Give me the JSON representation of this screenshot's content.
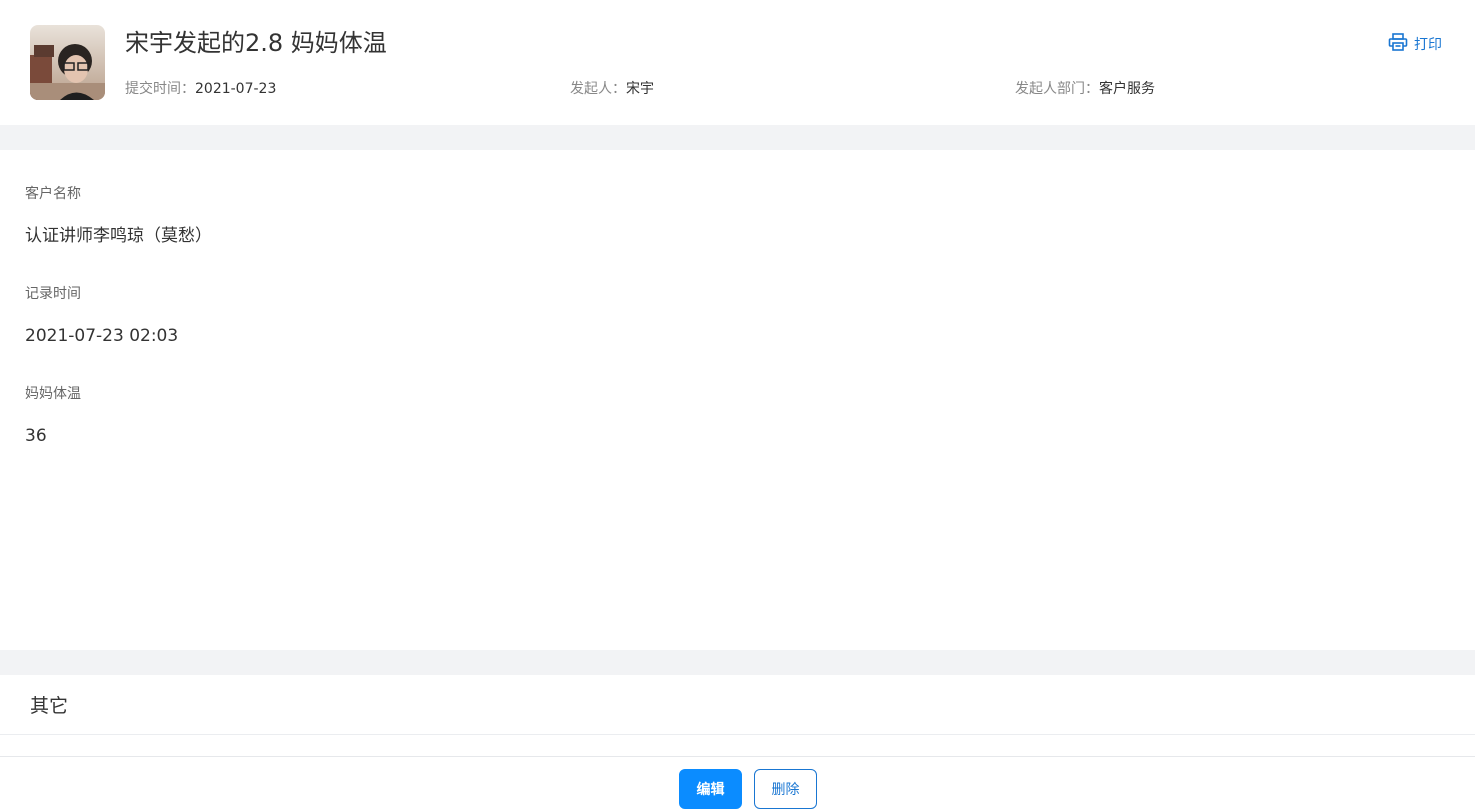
{
  "header": {
    "title": "宋宇发起的2.8 妈妈体温",
    "submit_time_label": "提交时间：",
    "submit_time_value": "2021-07-23",
    "initiator_label": "发起人：",
    "initiator_value": "宋宇",
    "department_label": "发起人部门：",
    "department_value": "客户服务",
    "print_label": "打印",
    "print_icon": "printer-icon",
    "avatar_icon": "user-avatar"
  },
  "fields": [
    {
      "label": "客户名称",
      "value": "认证讲师李鸣琼（莫愁）"
    },
    {
      "label": "记录时间",
      "value": "2021-07-23 02:03"
    },
    {
      "label": "妈妈体温",
      "value": "36"
    }
  ],
  "other": {
    "title": "其它"
  },
  "footer": {
    "edit_label": "编辑",
    "delete_label": "删除"
  },
  "colors": {
    "accent": "#1976d2",
    "primary_button": "#0b8cff",
    "band": "#f2f3f5"
  }
}
